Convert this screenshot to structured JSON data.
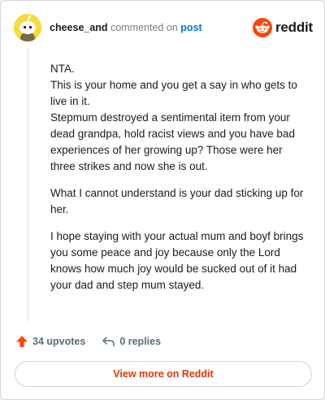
{
  "comment": {
    "username": "cheese_and",
    "verb": "commented on",
    "post_link": "post",
    "paragraphs": [
      [
        "NTA.",
        "This is your home and you get a say in who gets to live in it.",
        "Stepmum destroyed a sentimental item from your dead grandpa, hold racist views and you have bad experiences of her growing up? Those were her three strikes and now she is out."
      ],
      [
        "What I cannot understand is your dad sticking up for her."
      ],
      [
        "I hope staying with your actual mum and boyf brings you some peace and joy because only the Lord knows how much joy would be sucked out of it had your dad and step mum stayed."
      ]
    ]
  },
  "brand": {
    "word": "reddit",
    "color": "#ff4500"
  },
  "actions": {
    "upvotes": "34 upvotes",
    "replies": "0 replies"
  },
  "footer": {
    "view_more": "View more on Reddit"
  },
  "icons": {
    "avatar": "snoo-avatar-icon",
    "logo": "reddit-logo-icon",
    "upvote": "upvote-arrow-icon",
    "reply": "reply-arrow-icon"
  }
}
